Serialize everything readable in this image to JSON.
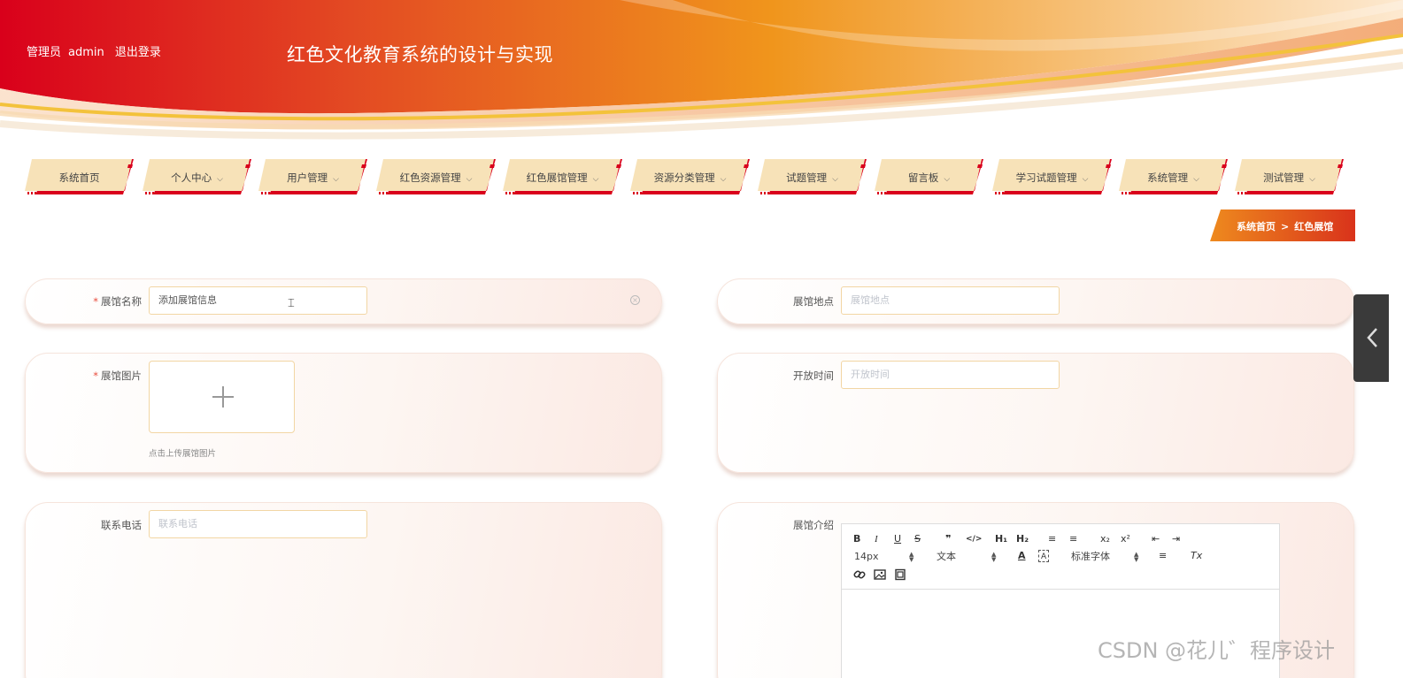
{
  "header": {
    "admin_role": "管理员",
    "admin_name": "admin",
    "logout_label": "退出登录",
    "site_title": "红色文化教育系统的设计与实现"
  },
  "nav": {
    "items": [
      {
        "label": "系统首页",
        "has_dropdown": false
      },
      {
        "label": "个人中心",
        "has_dropdown": true
      },
      {
        "label": "用户管理",
        "has_dropdown": true
      },
      {
        "label": "红色资源管理",
        "has_dropdown": true
      },
      {
        "label": "红色展馆管理",
        "has_dropdown": true
      },
      {
        "label": "资源分类管理",
        "has_dropdown": true
      },
      {
        "label": "试题管理",
        "has_dropdown": true
      },
      {
        "label": "留言板",
        "has_dropdown": true
      },
      {
        "label": "学习试题管理",
        "has_dropdown": true
      },
      {
        "label": "系统管理",
        "has_dropdown": true
      },
      {
        "label": "测试管理",
        "has_dropdown": true
      }
    ],
    "chevron": "⌵"
  },
  "breadcrumb": {
    "home": "系统首页",
    "separator": ">",
    "current": "红色展馆"
  },
  "form": {
    "name": {
      "label": "展馆名称",
      "required": true,
      "value": "添加展馆信息"
    },
    "location": {
      "label": "展馆地点",
      "placeholder": "展馆地点"
    },
    "image": {
      "label": "展馆图片",
      "required": true,
      "tip": "点击上传展馆图片"
    },
    "open_time": {
      "label": "开放时间",
      "placeholder": "开放时间"
    },
    "phone": {
      "label": "联系电话",
      "placeholder": "联系电话"
    },
    "intro": {
      "label": "展馆介绍"
    }
  },
  "editor": {
    "font_size": "14px",
    "paragraph": "文本",
    "font_family": "标准字体",
    "buttons": {
      "bold": "B",
      "italic": "I",
      "underline": "U",
      "strike": "S",
      "quote": "❞",
      "code": "</>",
      "h1": "H₁",
      "h2": "H₂",
      "ordered_list": "≡",
      "bullet_list": "≡",
      "subscript": "x₂",
      "superscript": "x²",
      "indent_left": "⇤",
      "indent_right": "⇥",
      "color": "A",
      "background": "A",
      "align": "≡",
      "clean": "Tx"
    }
  },
  "required_mark": "*",
  "watermark": "CSDN @花儿゛程序设计",
  "colors": {
    "primary_red": "#d9001b",
    "accent_orange": "#ee8a1e",
    "nav_bg": "#f7e2b8"
  }
}
